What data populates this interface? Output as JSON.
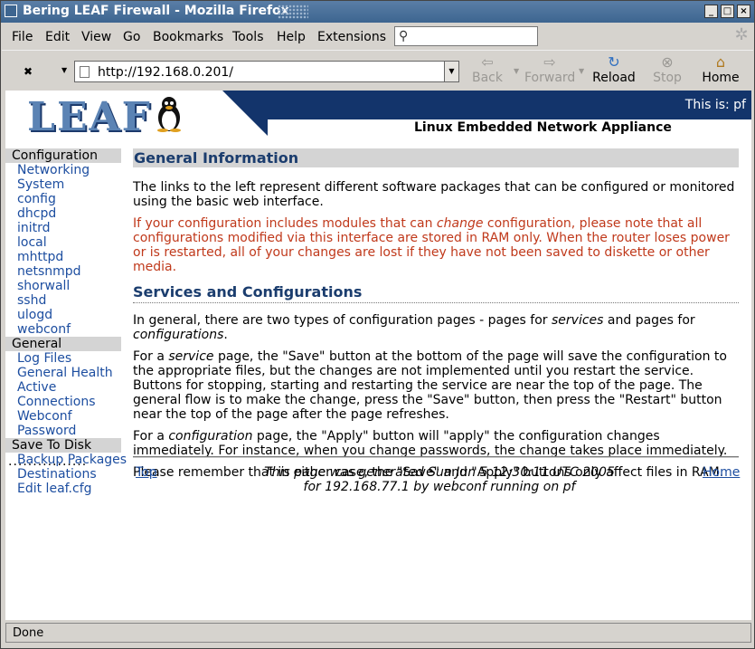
{
  "window": {
    "title": "Bering LEAF Firewall - Mozilla Firefox"
  },
  "menu": {
    "items": [
      "File",
      "Edit",
      "View",
      "Go",
      "Bookmarks",
      "Tools",
      "Help",
      "Extensions"
    ]
  },
  "nav": {
    "url": "http://192.168.0.201/",
    "back": "Back",
    "forward": "Forward",
    "reload": "Reload",
    "stop": "Stop",
    "home": "Home"
  },
  "banner": {
    "logo_text": "LEAF",
    "this_is": "This is: pf",
    "tagline": "Linux Embedded Network Appliance"
  },
  "sidebar": {
    "sections": [
      {
        "title": "Configuration",
        "links": [
          "Networking",
          "System",
          "config",
          "dhcpd",
          "initrd",
          "local",
          "mhttpd",
          "netsnmpd",
          "shorwall",
          "sshd",
          "ulogd",
          "webconf"
        ]
      },
      {
        "title": "General",
        "links": [
          "Log Files",
          "General Health",
          "Active",
          "Connections",
          "Webconf",
          "Password"
        ]
      },
      {
        "title": "Save To Disk",
        "links": [
          "Backup Packages",
          "Destinations",
          "Edit leaf.cfg"
        ]
      }
    ],
    "dots": "................"
  },
  "main": {
    "heading1": "General Information",
    "intro": "The links to the left represent different software packages that can be configured or monitored using the basic web interface.",
    "warn_before": "If your configuration includes modules that can ",
    "warn_em": "change",
    "warn_after": " configuration, please note that all configurations modified via this interface are stored in RAM only. When the router loses power or is restarted, all of your changes are lost if they have not been saved to diskette or other media.",
    "heading2": "Services and Configurations",
    "p1_a": "In general, there are two types of configuration pages - pages for ",
    "p1_em1": "services",
    "p1_b": " and pages for ",
    "p1_em2": "configurations",
    "p1_c": ".",
    "p2_a": "For a ",
    "p2_em": "service",
    "p2_b": " page, the \"Save\" button at the bottom of the page will save the configuration to the appropriate files, but the changes are not implemented until you restart the service. Buttons for stopping, starting and restarting the service are near the top of the page. The general flow is to make the change, press the \"Save\" button, then press the \"Restart\" button near the top of the page after the page refreshes.",
    "p3_a": "For a ",
    "p3_em": "configuration",
    "p3_b": " page, the \"Apply\" button will \"apply\" the configuration changes immediately. For instance, when you change passwords, the change takes place immediately.",
    "p4": "Please remember that in either case, the \"Save\" and \"Apply\" buttons only affect files in RAM."
  },
  "footer": {
    "top_link": "Top",
    "home_link": "Home",
    "line1": "This page was generated Sun Jun 5 12:30:11 UTC 2005",
    "line2": "for 192.168.77.1 by webconf running on pf"
  },
  "status": {
    "text": "Done"
  },
  "colors": {
    "link": "#1d4ea0",
    "heading": "#1b3d6e",
    "warning": "#c0391b",
    "banner_navy": "#13346b"
  }
}
